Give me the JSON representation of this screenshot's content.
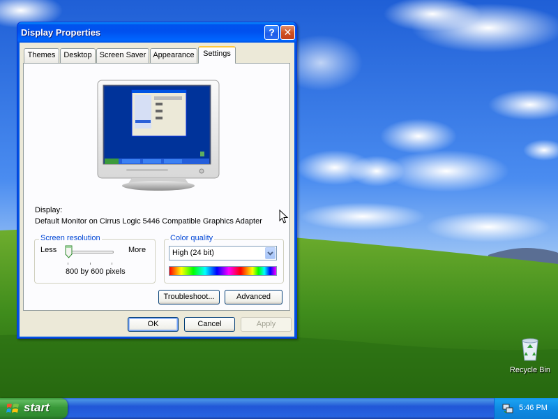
{
  "window": {
    "title": "Display Properties",
    "help_glyph": "?",
    "close_glyph": "✕"
  },
  "tabs": [
    {
      "label": "Themes",
      "active": false
    },
    {
      "label": "Desktop",
      "active": false
    },
    {
      "label": "Screen Saver",
      "active": false
    },
    {
      "label": "Appearance",
      "active": false
    },
    {
      "label": "Settings",
      "active": true
    }
  ],
  "settings": {
    "display_label": "Display:",
    "display_value": "Default Monitor on Cirrus Logic 5446 Compatible Graphics Adapter",
    "resolution": {
      "group_title": "Screen resolution",
      "less_label": "Less",
      "more_label": "More",
      "value_text": "800 by 600 pixels",
      "slider_level": 0
    },
    "color_quality": {
      "group_title": "Color quality",
      "selected": "High (24 bit)"
    },
    "troubleshoot_label": "Troubleshoot...",
    "advanced_label": "Advanced"
  },
  "footer": {
    "ok_label": "OK",
    "cancel_label": "Cancel",
    "apply_label": "Apply",
    "apply_enabled": false
  },
  "desktop_icons": [
    {
      "label": "Recycle Bin",
      "icon": "recycle-bin-icon"
    }
  ],
  "taskbar": {
    "start_label": "start",
    "clock": "5:46 PM"
  },
  "colors": {
    "title_blue": "#0054e3",
    "dialog_bg": "#ece9d8",
    "group_title": "#0046d5",
    "start_green": "#389838",
    "taskbar_blue": "#2157d7"
  }
}
